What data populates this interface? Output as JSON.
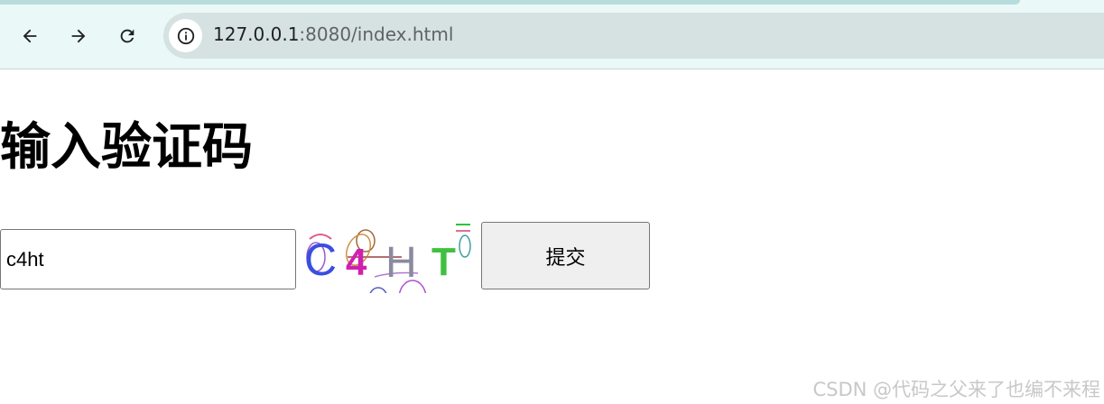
{
  "browser": {
    "url_host": "127.0.0.1",
    "url_rest": ":8080/index.html",
    "icons": [
      "back-arrow-icon",
      "forward-arrow-icon",
      "reload-icon",
      "site-info-icon"
    ]
  },
  "page": {
    "title": "输入验证码",
    "input_value": "c4ht",
    "captcha_text": "C4HT",
    "submit_label": "提交"
  },
  "watermark": "CSDN @代码之父来了也编不来程",
  "colors": {
    "chrome_bg": "#eaf8f8",
    "omnibox_bg": "#d6e2e2",
    "button_bg": "#efefef"
  }
}
